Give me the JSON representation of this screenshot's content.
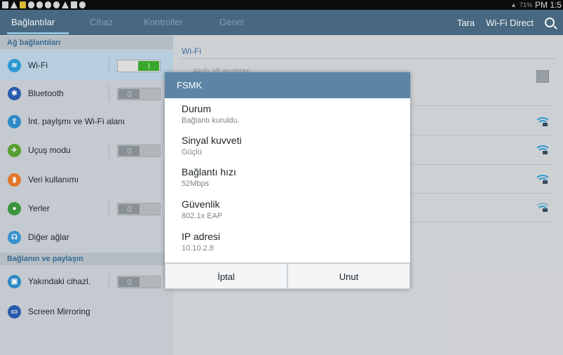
{
  "status_bar": {
    "battery": "71%",
    "time": "PM 1:5"
  },
  "action_bar": {
    "tabs": [
      "Bağlantılar",
      "Cihaz",
      "Kontroller",
      "Genel"
    ],
    "scan_label": "Tara",
    "wifi_direct_label": "Wi-Fi Direct"
  },
  "sidebar": {
    "section1": "Ağ bağlantıları",
    "section2": "Bağlanın ve paylaşın",
    "items": [
      {
        "label": "Wi-Fi",
        "icon": "wifi-icon",
        "color": "#2f9fdb"
      },
      {
        "label": "Bluetooth",
        "icon": "bluetooth-icon",
        "color": "#2b5fb3"
      },
      {
        "label": "İnt. paylşmı ve Wi-Fi alanı",
        "icon": "hotspot-icon",
        "color": "#2f8fd0"
      },
      {
        "label": "Uçuş modu",
        "icon": "airplane-icon",
        "color": "#5aa532"
      },
      {
        "label": "Veri kullanımı",
        "icon": "data-usage-icon",
        "color": "#ec7b2b"
      },
      {
        "label": "Yerler",
        "icon": "location-icon",
        "color": "#3f9b3f"
      },
      {
        "label": "Diğer ağlar",
        "icon": "more-networks-icon",
        "color": "#3a9ad6"
      },
      {
        "label": "Yakındaki cihazl.",
        "icon": "nearby-devices-icon",
        "color": "#2f8fd0"
      },
      {
        "label": "Screen Mirroring",
        "icon": "screen-mirroring-icon",
        "color": "#2b5fb3"
      }
    ]
  },
  "content": {
    "header": "Wi-Fi",
    "smart_switch_label": "Akıllı ağ anahtarı"
  },
  "dialog": {
    "title": "FSMK",
    "rows": [
      {
        "label": "Durum",
        "value": "Bağlantı kuruldu."
      },
      {
        "label": "Sinyal kuvveti",
        "value": "Güçlü"
      },
      {
        "label": "Bağlantı hızı",
        "value": "52Mbps"
      },
      {
        "label": "Güvenlik",
        "value": "802.1x EAP"
      },
      {
        "label": "IP adresi",
        "value": "10.10.2.8"
      }
    ],
    "cancel_label": "İptal",
    "forget_label": "Unut"
  }
}
